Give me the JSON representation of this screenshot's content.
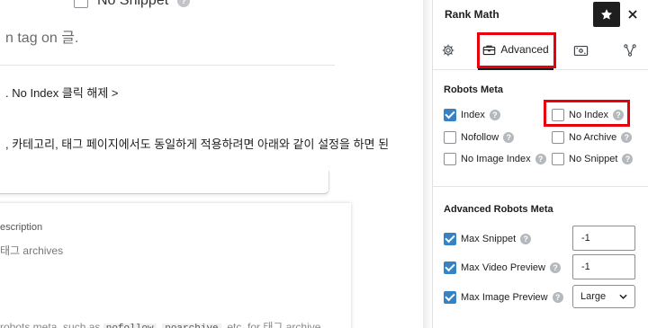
{
  "editor": {
    "snippet_label": "No Snippet",
    "line1": "n tag on 글.",
    "line2": ". No Index 클릭 해제 >",
    "line3": ", 카테고리, 태그 페이지에서도 동일하게 적용하려면 아래와 같이 설정을 하면 된",
    "desc_label": "escription",
    "tag_label": "태그 archives",
    "bottom_text": "robots meta, such as",
    "bottom_code1": "nofollow",
    "bottom_sep": ",",
    "bottom_code2": "noarchive",
    "bottom_tail": ", etc. for 태그 archive"
  },
  "sidebar": {
    "title": "Rank Math",
    "tabs": {
      "general_icon": "gear-icon",
      "advanced_label": "Advanced",
      "advanced_icon": "briefcase-icon",
      "social_icon": "social-card-icon",
      "schema_icon": "schema-nodes-icon"
    },
    "robots": {
      "title": "Robots Meta",
      "index": "Index",
      "no_index": "No Index",
      "nofollow": "Nofollow",
      "no_archive": "No Archive",
      "no_image_index": "No Image Index",
      "no_snippet": "No Snippet",
      "states": {
        "index": true,
        "no_index": false,
        "nofollow": false,
        "no_archive": false,
        "no_image_index": false,
        "no_snippet": false
      }
    },
    "advanced_robots": {
      "title": "Advanced Robots Meta",
      "max_snippet_label": "Max Snippet",
      "max_snippet_value": "-1",
      "max_video_label": "Max Video Preview",
      "max_video_value": "-1",
      "max_image_label": "Max Image Preview",
      "max_image_value": "Large"
    }
  },
  "colors": {
    "checkbox_checked": "#3582c4",
    "highlight": "#e8000d",
    "text": "#1e1e1e"
  }
}
